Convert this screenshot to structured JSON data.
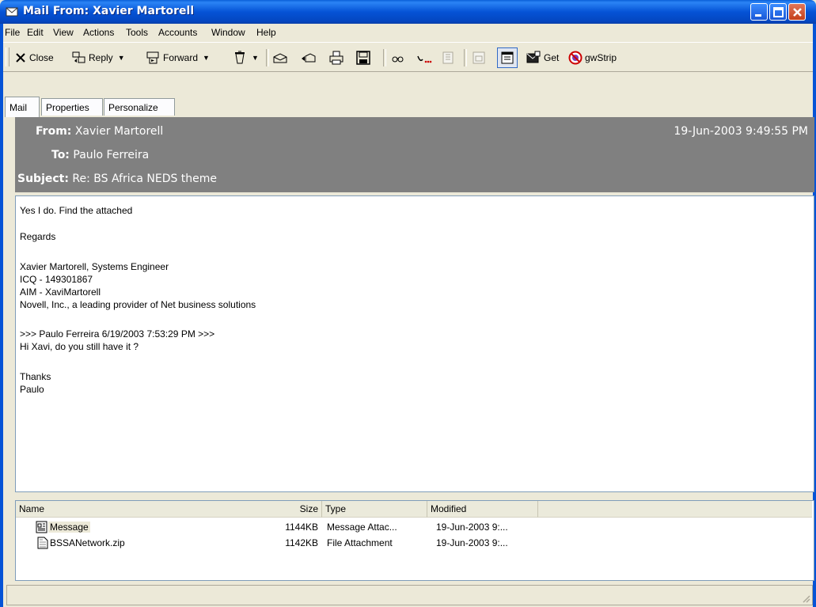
{
  "window": {
    "title": "Mail From: Xavier Martorell"
  },
  "menu": [
    "File",
    "Edit",
    "View",
    "Actions",
    "Tools",
    "Accounts",
    "Window",
    "Help"
  ],
  "toolbar": {
    "close_label": "Close",
    "reply_label": "Reply",
    "forward_label": "Forward",
    "get_label": "Get",
    "gwstrip_label": "gwStrip"
  },
  "tabs": [
    "Mail",
    "Properties",
    "Personalize"
  ],
  "header": {
    "from_label": "From:",
    "from": "Xavier Martorell",
    "to_label": "To:",
    "to": "Paulo Ferreira",
    "subject_label": "Subject:",
    "subject": "Re: BS Africa NEDS theme",
    "date": "19-Jun-2003 9:49:55 PM"
  },
  "body_lines": [
    "Yes I do. Find the attached",
    "",
    "Regards",
    "",
    "Xavier Martorell, Systems Engineer",
    "ICQ - 149301867",
    "AIM - XaviMartorell",
    "Novell, Inc., a leading provider of Net business solutions",
    "",
    ">>> Paulo Ferreira 6/19/2003 7:53:29 PM >>>",
    "Hi Xavi, do you still have it ?",
    "",
    "Thanks",
    "Paulo"
  ],
  "attachments": {
    "columns": [
      "Name",
      "Size",
      "Type",
      "Modified"
    ],
    "rows": [
      {
        "name": "Message",
        "size": "1144KB",
        "type": "Message Attac...",
        "modified": "19-Jun-2003 9:...",
        "icon": "message-icon"
      },
      {
        "name": "BSSANetwork.zip",
        "size": "1142KB",
        "type": "File Attachment",
        "modified": "19-Jun-2003 9:...",
        "icon": "zip-file-icon"
      }
    ]
  },
  "colors": {
    "titlebar": "#0553d6",
    "header_bg": "#808080",
    "window_bg": "#ece9d8"
  }
}
